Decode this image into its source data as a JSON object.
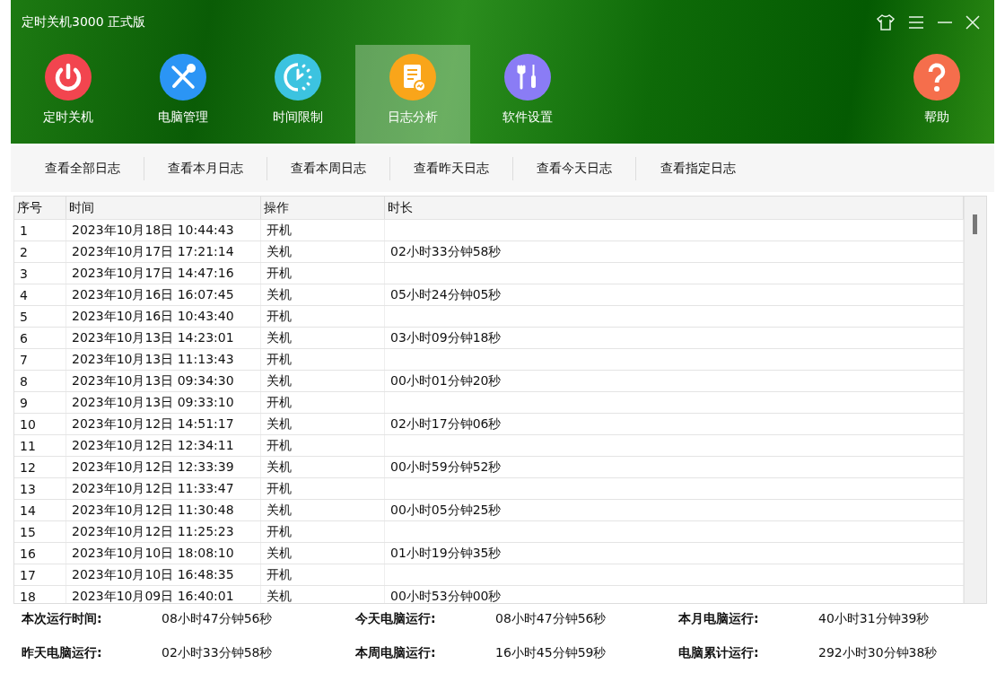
{
  "window": {
    "title": "定时关机3000 正式版"
  },
  "nav": [
    {
      "label": "定时关机",
      "kind": "power",
      "color": "#f2454f",
      "selected": false
    },
    {
      "label": "电脑管理",
      "kind": "tools",
      "color": "#2b95f5",
      "selected": false
    },
    {
      "label": "时间限制",
      "kind": "timer",
      "color": "#3cc3e0",
      "selected": false
    },
    {
      "label": "日志分析",
      "kind": "log",
      "color": "#f9a51a",
      "selected": true
    },
    {
      "label": "软件设置",
      "kind": "settings",
      "color": "#8a7cf5",
      "selected": false
    }
  ],
  "help": {
    "label": "帮助",
    "color": "#f56e4c"
  },
  "toolbar": [
    "查看全部日志",
    "查看本月日志",
    "查看本周日志",
    "查看昨天日志",
    "查看今天日志",
    "查看指定日志"
  ],
  "table": {
    "columns": [
      "序号",
      "时间",
      "操作",
      "时长"
    ],
    "rows": [
      [
        "1",
        "2023年10月18日 10:44:43",
        "开机"
      ],
      [
        "2",
        "2023年10月17日 17:21:14",
        "关机",
        "02小时33分钟58秒"
      ],
      [
        "3",
        "2023年10月17日 14:47:16",
        "开机"
      ],
      [
        "4",
        "2023年10月16日 16:07:45",
        "关机",
        "05小时24分钟05秒"
      ],
      [
        "5",
        "2023年10月16日 10:43:40",
        "开机"
      ],
      [
        "6",
        "2023年10月13日 14:23:01",
        "关机",
        "03小时09分钟18秒"
      ],
      [
        "7",
        "2023年10月13日 11:13:43",
        "开机"
      ],
      [
        "8",
        "2023年10月13日 09:34:30",
        "关机",
        "00小时01分钟20秒"
      ],
      [
        "9",
        "2023年10月13日 09:33:10",
        "开机"
      ],
      [
        "10",
        "2023年10月12日 14:51:17",
        "关机",
        "02小时17分钟06秒"
      ],
      [
        "11",
        "2023年10月12日 12:34:11",
        "开机"
      ],
      [
        "12",
        "2023年10月12日 12:33:39",
        "关机",
        "00小时59分钟52秒"
      ],
      [
        "13",
        "2023年10月12日 11:33:47",
        "开机"
      ],
      [
        "14",
        "2023年10月12日 11:30:48",
        "关机",
        "00小时05分钟25秒"
      ],
      [
        "15",
        "2023年10月12日 11:25:23",
        "开机"
      ],
      [
        "16",
        "2023年10月10日 18:08:10",
        "关机",
        "01小时19分钟35秒"
      ],
      [
        "17",
        "2023年10月10日 16:48:35",
        "开机"
      ],
      [
        "18",
        "2023年10月09日 16:40:01",
        "关机",
        "00小时53分钟00秒"
      ]
    ]
  },
  "stats": [
    {
      "label": "本次运行时间:",
      "value": "08小时47分钟56秒"
    },
    {
      "label": "今天电脑运行:",
      "value": "08小时47分钟56秒"
    },
    {
      "label": "本月电脑运行:",
      "value": "40小时31分钟39秒"
    },
    {
      "label": "昨天电脑运行:",
      "value": "02小时33分钟58秒"
    },
    {
      "label": "本周电脑运行:",
      "value": "16小时45分钟59秒"
    },
    {
      "label": "电脑累计运行:",
      "value": "292小时30分钟38秒"
    }
  ]
}
